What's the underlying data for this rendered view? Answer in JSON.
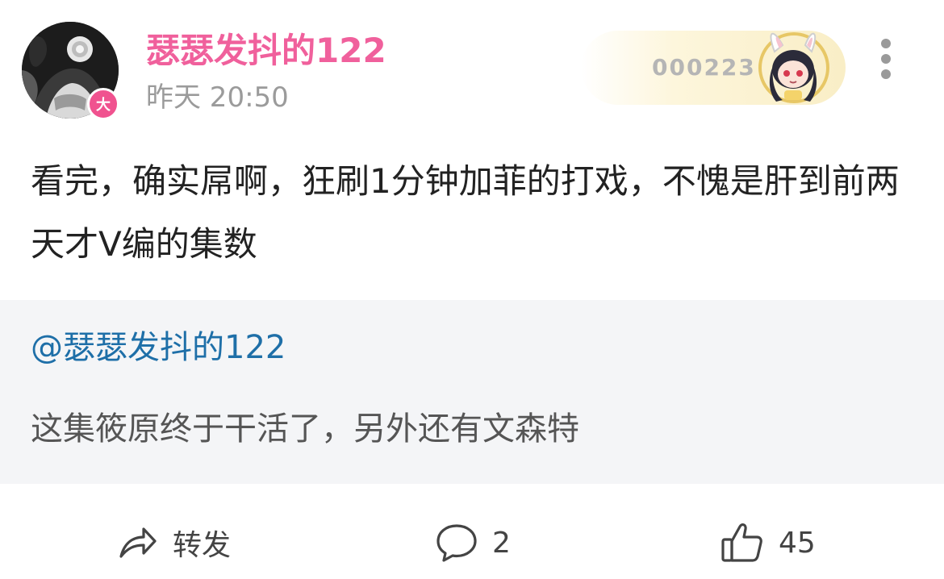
{
  "post": {
    "author": "瑟瑟发抖的122",
    "time": "昨天 20:50",
    "level_badge": "大",
    "fan_badge_number": "000223",
    "content": "看完，确实屌啊，狂刷1分钟加菲的打戏，不愧是肝到前两天才V编的集数"
  },
  "quote": {
    "mention": "@瑟瑟发抖的122",
    "text": "这集筱原终于干活了，另外还有文森特"
  },
  "actions": {
    "share_label": "转发",
    "comment_count": "2",
    "like_count": "45"
  },
  "colors": {
    "username": "#f0609c",
    "badge": "#f0528f",
    "mention": "#1e6fa8",
    "quote_bg": "#f4f5f7"
  }
}
